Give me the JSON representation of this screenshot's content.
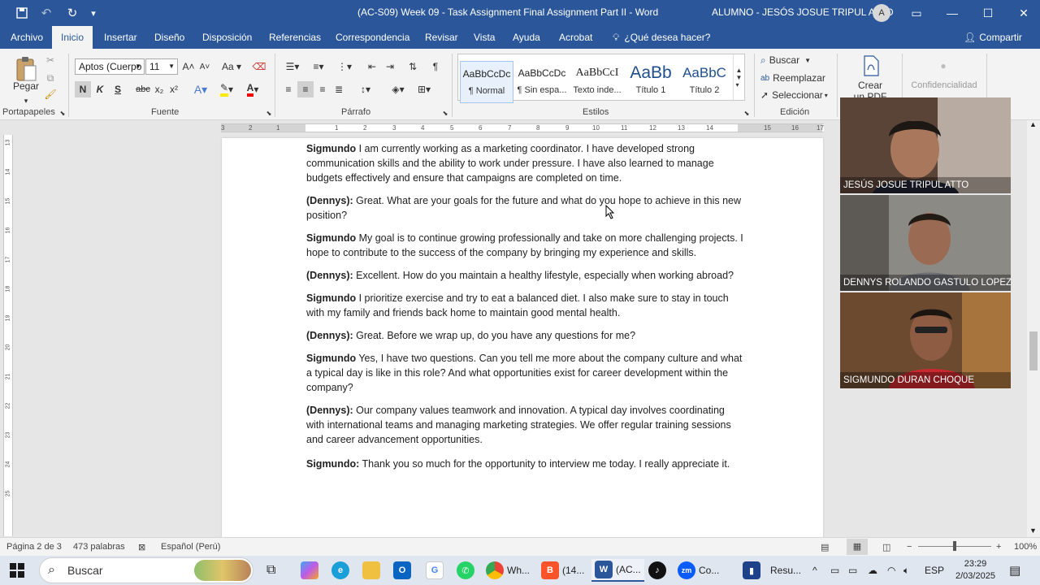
{
  "title_bar": {
    "doc_title": "(AC-S09) Week 09 - Task Assignment  Final Assignment Part II  -  Word",
    "user_name": "ALUMNO - JESÓS JOSUE TRIPUL ATTO",
    "avatar_initial": "A",
    "icons": [
      "save-icon",
      "undo-icon",
      "redo-icon",
      "customize-icon",
      "ribbon-display-icon",
      "minimize-icon",
      "maximize-icon",
      "close-icon"
    ]
  },
  "tabs": [
    {
      "label": "Archivo"
    },
    {
      "label": "Inicio",
      "active": true
    },
    {
      "label": "Insertar"
    },
    {
      "label": "Diseño"
    },
    {
      "label": "Disposición"
    },
    {
      "label": "Referencias"
    },
    {
      "label": "Correspondencia"
    },
    {
      "label": "Revisar"
    },
    {
      "label": "Vista"
    },
    {
      "label": "Ayuda"
    },
    {
      "label": "Acrobat"
    },
    {
      "label": "¿Qué desea hacer?"
    }
  ],
  "share_label": "Compartir",
  "ribbon": {
    "clipboard": {
      "paste": "Pegar",
      "group": "Portapapeles"
    },
    "font": {
      "name": "Aptos (Cuerpo",
      "size": "11",
      "group": "Fuente",
      "bold": "N",
      "italic": "K",
      "underline": "S",
      "strike": "abc",
      "sub": "x₂",
      "sup": "x²",
      "case": "Aa"
    },
    "paragraph": {
      "group": "Párrafo"
    },
    "styles": {
      "group": "Estilos",
      "items": [
        {
          "preview": "AaBbCcDc",
          "name": "¶ Normal"
        },
        {
          "preview": "AaBbCcDc",
          "name": "¶ Sin espa..."
        },
        {
          "preview": "AaBbCcI",
          "name": "Texto inde..."
        },
        {
          "preview": "AaBb",
          "name": "Título 1"
        },
        {
          "preview": "AaBbC",
          "name": "Título 2"
        }
      ]
    },
    "editing": {
      "group": "Edición",
      "find": "Buscar",
      "replace": "Reemplazar",
      "select": "Seleccionar"
    },
    "acrobat": {
      "create": "Crear",
      "create2": "un PDF"
    },
    "sensitivity": {
      "label": "Confidencialidad"
    }
  },
  "document": {
    "paragraphs": [
      {
        "speaker": "Sigmundo",
        "text": " I am currently working as a marketing coordinator. I have developed strong communication skills and the ability to work under pressure. I have also learned to manage budgets effectively and ensure that campaigns are completed on time."
      },
      {
        "speaker": "(Dennys):",
        "text": " Great. What are your goals for the future and what do you hope to achieve in this new position?"
      },
      {
        "speaker": "Sigmundo",
        "text": " My goal is to continue growing professionally and take on more challenging projects. I hope to contribute to the success of the company by bringing my experience and skills."
      },
      {
        "speaker": "(Dennys):",
        "text": " Excellent. How do you maintain a healthy lifestyle, especially when working abroad?"
      },
      {
        "speaker": "Sigmundo",
        "text": " I prioritize exercise and try to eat a balanced diet. I also make sure to stay in touch with my family and friends back home to maintain good mental health."
      },
      {
        "speaker": "(Dennys):",
        "text": " Great. Before we wrap up, do you have any questions for me?"
      },
      {
        "speaker": "Sigmundo",
        "text": " Yes, I have two questions. Can you tell me more about the company culture and what a typical day is like in this role? And what opportunities exist for career development within the company?"
      },
      {
        "speaker": "(Dennys):",
        "text": " Our company values teamwork and innovation. A typical day involves coordinating with international teams and managing marketing strategies. We offer regular training sessions and career advancement opportunities."
      },
      {
        "speaker": "Sigmundo:",
        "text": " Thank you so much for the opportunity to interview me today. I really appreciate it."
      }
    ]
  },
  "ruler": {
    "h_ticks": [
      "3",
      "2",
      "1",
      "1",
      "2",
      "3",
      "4",
      "5",
      "6",
      "7",
      "8",
      "9",
      "10",
      "11",
      "12",
      "13",
      "14",
      "15",
      "16",
      "17"
    ],
    "v_ticks": [
      "13",
      "14",
      "15",
      "16",
      "17",
      "18",
      "19",
      "20",
      "21",
      "22",
      "23",
      "24",
      "25"
    ]
  },
  "participants": [
    {
      "name": "JESÚS JOSUE TRIPUL ATTO"
    },
    {
      "name": "DENNYS ROLANDO GASTULO LOPEZ"
    },
    {
      "name": "SIGMUNDO DURAN CHOQUE"
    }
  ],
  "status_bar": {
    "page": "Página 2 de 3",
    "words": "473 palabras",
    "language": "Español (Perú)",
    "zoom": "100%"
  },
  "taskbar": {
    "search_placeholder": "Buscar",
    "items": [
      {
        "label": "Wh..."
      },
      {
        "label": "(14..."
      },
      {
        "label": "(AC..."
      },
      {
        "label": "Co..."
      },
      {
        "label": "Resu..."
      }
    ],
    "lang": "ESP",
    "time": "23:29",
    "date": "2/03/2025"
  },
  "colors": {
    "word_blue": "#2b579a",
    "ribbon_bg": "#f3f3f3",
    "page_bg": "#e6e6e6"
  }
}
